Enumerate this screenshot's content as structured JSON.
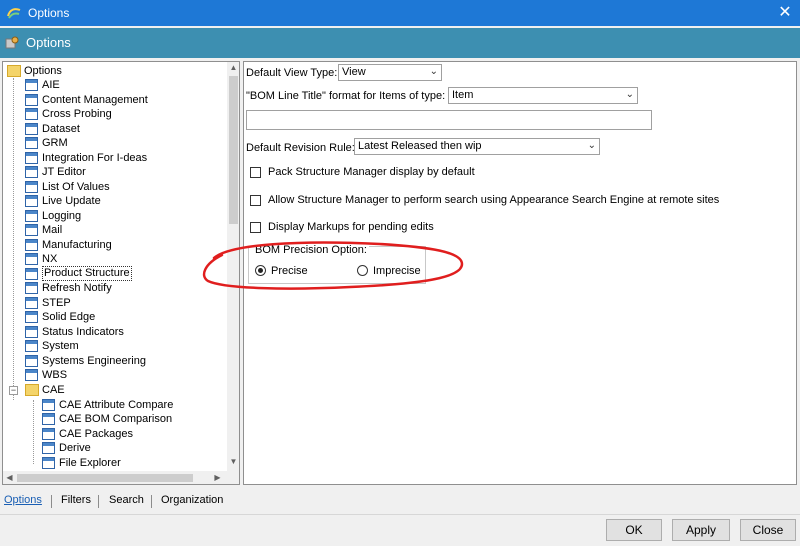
{
  "window": {
    "title": "Options",
    "close_glyph": "✕",
    "accent": "#1e78d6"
  },
  "header": {
    "title": "Options",
    "color": "#3d8fb1"
  },
  "tree": {
    "root": "Options",
    "items": [
      "AIE",
      "Content Management",
      "Cross Probing",
      "Dataset",
      "GRM",
      "Integration For I-deas",
      "JT Editor",
      "List Of Values",
      "Live Update",
      "Logging",
      "Mail",
      "Manufacturing",
      "NX",
      "Product Structure",
      "Refresh Notify",
      "STEP",
      "Solid Edge",
      "Status Indicators",
      "System",
      "Systems Engineering",
      "WBS"
    ],
    "selected": "Product Structure",
    "cae_folder": "CAE",
    "cae_children": [
      "CAE Attribute Compare",
      "CAE BOM Comparison",
      "CAE Packages",
      "Derive",
      "File Explorer"
    ]
  },
  "content": {
    "default_view_type": {
      "label": "Default View Type:",
      "value": "View"
    },
    "bom_line_title": {
      "label": "\"BOM Line Title\" format for Items of type:",
      "value": "Item"
    },
    "title_format_text": "",
    "default_revision_rule": {
      "label": "Default Revision Rule:",
      "value": "Latest Released then wip"
    },
    "checkboxes": [
      {
        "label": "Pack Structure Manager display by default",
        "checked": false
      },
      {
        "label": "Allow Structure Manager to perform search using Appearance Search Engine at remote sites",
        "checked": false
      },
      {
        "label": "Display Markups for pending edits",
        "checked": false
      }
    ],
    "bom_precision": {
      "legend": "BOM Precision Option:",
      "options": [
        {
          "label": "Precise",
          "checked": true
        },
        {
          "label": "Imprecise",
          "checked": false
        }
      ]
    }
  },
  "bottom_tabs": [
    "Options",
    "Filters",
    "Search",
    "Organization"
  ],
  "active_tab": "Options",
  "footer": {
    "ok": "OK",
    "apply": "Apply",
    "close": "Close"
  },
  "annotation_color": "#e01e1e"
}
